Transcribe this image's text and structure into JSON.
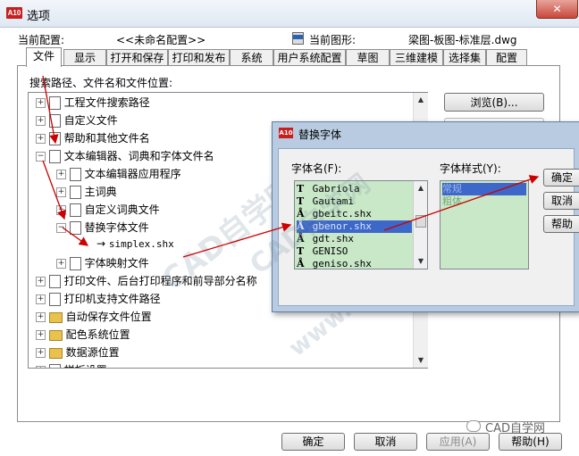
{
  "window": {
    "title": "选项",
    "app_icon": "A10"
  },
  "header": {
    "profile_label": "当前配置:",
    "profile_value": "<<未命名配置>>",
    "drawing_label": "当前图形:",
    "drawing_value": "梁图-板图-标准层.dwg"
  },
  "tabs": [
    "文件",
    "显示",
    "打开和保存",
    "打印和发布",
    "系统",
    "用户系统配置",
    "草图",
    "三维建模",
    "选择集",
    "配置"
  ],
  "files": {
    "section_label": "搜索路径、文件名和文件位置:",
    "browse_button": "浏览(B)...",
    "tree": [
      {
        "label": "工程文件搜索路径",
        "exp": "+",
        "level": 0,
        "icon": "doc"
      },
      {
        "label": "自定义文件",
        "exp": "+",
        "level": 0,
        "icon": "doc"
      },
      {
        "label": "帮助和其他文件名",
        "exp": "+",
        "level": 0,
        "icon": "doc"
      },
      {
        "label": "文本编辑器、词典和字体文件名",
        "exp": "−",
        "level": 0,
        "icon": "doc"
      },
      {
        "label": "文本编辑器应用程序",
        "exp": "+",
        "level": 1,
        "icon": "pen"
      },
      {
        "label": "主词典",
        "exp": "+",
        "level": 1,
        "icon": "doc"
      },
      {
        "label": "自定义词典文件",
        "exp": "+",
        "level": 1,
        "icon": "doc"
      },
      {
        "label": "替换字体文件",
        "exp": "−",
        "level": 1,
        "icon": "doc"
      },
      {
        "label": "simplex.shx",
        "exp": "",
        "level": 2,
        "icon": "arrow"
      },
      {
        "label": "字体映射文件",
        "exp": "+",
        "level": 1,
        "icon": "doc"
      },
      {
        "label": "打印文件、后台打印程序和前导部分名称",
        "exp": "+",
        "level": 0,
        "icon": "doc"
      },
      {
        "label": "打印机支持文件路径",
        "exp": "+",
        "level": 0,
        "icon": "doc"
      },
      {
        "label": "自动保存文件位置",
        "exp": "+",
        "level": 0,
        "icon": "folder"
      },
      {
        "label": "配色系统位置",
        "exp": "+",
        "level": 0,
        "icon": "folder"
      },
      {
        "label": "数据源位置",
        "exp": "+",
        "level": 0,
        "icon": "folder"
      },
      {
        "label": "样板设置",
        "exp": "+",
        "level": 0,
        "icon": "doc"
      }
    ]
  },
  "footer": {
    "ok": "确定",
    "cancel": "取消",
    "apply": "应用(A)",
    "help": "帮助(H)"
  },
  "dialog": {
    "title": "替换字体",
    "font_name_label": "字体名(F):",
    "font_style_label": "字体样式(Y):",
    "fonts": [
      "Gabriola",
      "Gautami",
      "gbeitc.shx",
      "gbenor.shx",
      "gdt.shx",
      "GENISO",
      "geniso.shx"
    ],
    "font_icons": [
      "tt",
      "tt",
      "shx",
      "shx",
      "shx",
      "tt",
      "shx"
    ],
    "selected_font_index": 3,
    "styles": [
      "常规",
      "粗体"
    ],
    "selected_style_index": 0,
    "ok_button": "确定",
    "cancel_button": "取消",
    "help_button": "帮助"
  },
  "watermark": {
    "text1": "CAD自学网",
    "text2": "www.cadzxw.com",
    "badge": "CAD自学网"
  },
  "colors": {
    "arrow": "#cc0000",
    "listbox_bg": "#c8e8c8",
    "selection": "#3d67c9"
  }
}
